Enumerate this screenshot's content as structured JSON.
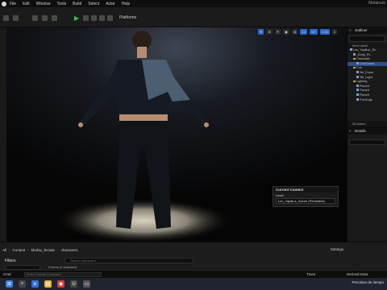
{
  "menu": {
    "items": [
      "File",
      "Edit",
      "Window",
      "Tools",
      "Build",
      "Select",
      "Actor",
      "Help"
    ],
    "app_title": "Metahum"
  },
  "toolbar": {
    "platforms_label": "Platforms"
  },
  "viewport": {
    "tool_values": [
      "10",
      "10°",
      "0.25",
      "4"
    ]
  },
  "current_context": {
    "title": "Current Context",
    "level_label": "Level",
    "level_value": "Lev_Yapikuc_Scene (Persistent)"
  },
  "outliner": {
    "title": "Outliner",
    "col_header": "Item Label",
    "rows": [
      {
        "label": "Lev_Yapikuc_Sc",
        "type": "level",
        "indent": 0
      },
      {
        "label": "_Body_Ex",
        "type": "actor",
        "indent": 1
      },
      {
        "label": "Cinematic",
        "type": "folder",
        "indent": 1
      },
      {
        "label": "CineCamA",
        "type": "actor",
        "indent": 2,
        "selected": true
      },
      {
        "label": "Cos",
        "type": "folder",
        "indent": 1
      },
      {
        "label": "Skl_Expor",
        "type": "actor",
        "indent": 2
      },
      {
        "label": "Skl_Light",
        "type": "actor",
        "indent": 2
      },
      {
        "label": "Lighting",
        "type": "folder",
        "indent": 1
      },
      {
        "label": "Plane3",
        "type": "actor",
        "indent": 2
      },
      {
        "label": "Plane4",
        "type": "actor",
        "indent": 2
      },
      {
        "label": "Plane5",
        "type": "actor",
        "indent": 2
      },
      {
        "label": "PointLigh",
        "type": "actor",
        "indent": 2
      }
    ],
    "footer": "26 actors"
  },
  "details": {
    "title": "Details"
  },
  "content_browser": {
    "breadcrumbs": [
      "All",
      "Content",
      "khofax_female",
      "character1"
    ],
    "settings_label": "Settings",
    "filters_label": "Filters",
    "search_placeholder": "Search character1",
    "item_count": "0 items (1 selected)"
  },
  "statusbar": {
    "cmd_label": "Cmd",
    "cmd_placeholder": "Enter Console Command",
    "trace_label": "Trace",
    "derived_label": "Derived Data"
  },
  "taskbar": {
    "tray_text": "Precision de tiempo"
  }
}
